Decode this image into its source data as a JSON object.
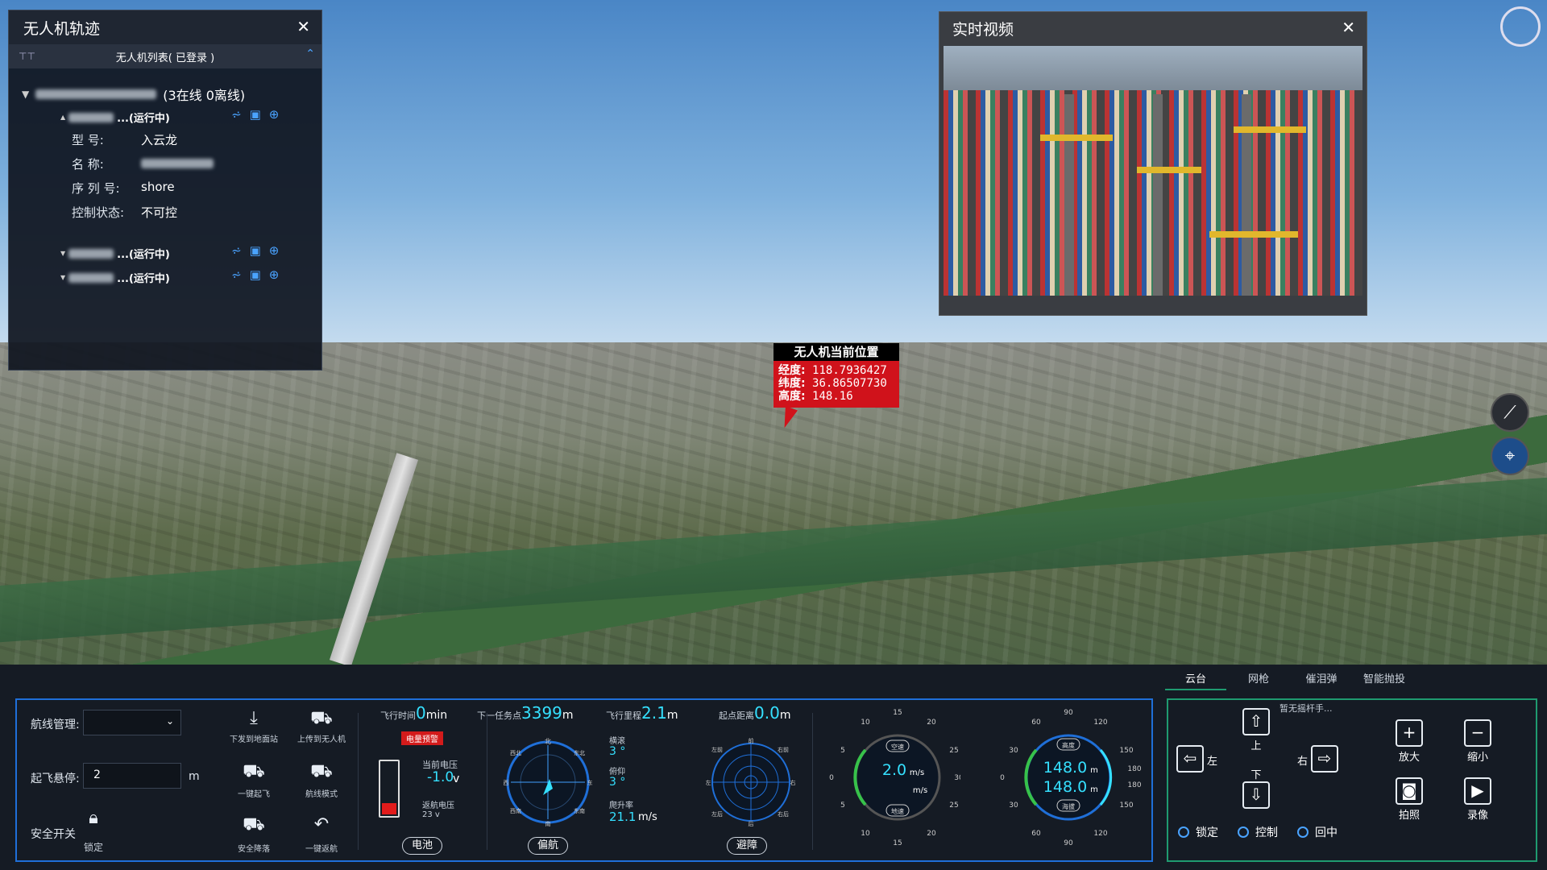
{
  "track_panel": {
    "title": "无人机轨迹",
    "close": "✕",
    "list_title": "无人机列表( 已登录 )",
    "group_status": "(3在线 0离线)",
    "drones": [
      {
        "status": "...(运行中)"
      },
      {
        "status": "...(运行中)"
      },
      {
        "status": "...(运行中)"
      }
    ],
    "details": [
      {
        "key": "型 号:",
        "value": "入云龙"
      },
      {
        "key": "名 称:",
        "value": ""
      },
      {
        "key": "序 列 号:",
        "value": "shore"
      },
      {
        "key": "控制状态:",
        "value": "不可控"
      }
    ]
  },
  "video_panel": {
    "title": "实时视频",
    "close": "✕"
  },
  "position_popup": {
    "title": "无人机当前位置",
    "lon_label": "经度:",
    "lon": "118.7936427",
    "lat_label": "纬度:",
    "lat": "36.86507730",
    "alt_label": "高度:",
    "alt": "148.16"
  },
  "dashboard": {
    "route_label": "航线管理:",
    "hover_label": "起飞悬停:",
    "hover_value": "2",
    "hover_unit": "m",
    "safety_label": "安全开关",
    "lock_label": "锁定",
    "actions": [
      {
        "label": "下发到地面站",
        "icon": "download-icon"
      },
      {
        "label": "上传到无人机",
        "icon": "drone-upload-icon"
      },
      {
        "label": "一键起飞",
        "icon": "takeoff-icon"
      },
      {
        "label": "航线模式",
        "icon": "route-mode-icon"
      },
      {
        "label": "安全降落",
        "icon": "landing-icon"
      },
      {
        "label": "一键返航",
        "icon": "return-icon"
      }
    ],
    "flight_time_label": "飞行时间",
    "flight_time": "0",
    "flight_time_unit": "min",
    "next_waypoint_label": "下一任务点",
    "next_waypoint": "3399",
    "next_waypoint_unit": "m",
    "mileage_label": "飞行里程",
    "mileage": "2.1",
    "mileage_unit": "m",
    "home_dist_label": "起点距离",
    "home_dist": "0.0",
    "home_dist_unit": "m",
    "battery_warning": "电量预警",
    "voltage_label": "当前电压",
    "voltage": "-1.0",
    "voltage_unit": "v",
    "return_voltage_label": "返航电压",
    "return_voltage": "23 v",
    "battery_level": 0.2,
    "battery_pill": "电池",
    "heading_pill": "偏航",
    "roll_label": "横滚",
    "roll": "3 °",
    "pitch_label": "俯仰",
    "pitch": "3 °",
    "climb_label": "爬升率",
    "climb": "21.1",
    "climb_unit": "m/s",
    "avoid_pill": "避障",
    "airspeed_label": "空速",
    "airspeed": "2.0",
    "airspeed_unit": "m/s",
    "ground_speed_label": "地速",
    "ground_speed_unit": "m/s",
    "speed_ticks": [
      "15",
      "20",
      "25",
      "30",
      "25",
      "20",
      "15",
      "10",
      "5",
      "0",
      "5",
      "10"
    ],
    "altitude_label": "高度",
    "altitude": "148.0",
    "altitude_unit": "m",
    "baro_label": "海拔",
    "baro": "148.0",
    "baro_unit": "m",
    "alt_ticks": [
      "90",
      "120",
      "150",
      "180",
      "180",
      "150",
      "120",
      "90",
      "60",
      "30",
      "0",
      "30",
      "60"
    ],
    "compass_labels": [
      "北",
      "东北",
      "东",
      "东南",
      "南",
      "西南",
      "西",
      "西北"
    ],
    "avoid_labels": [
      "前",
      "右前",
      "右",
      "右后",
      "后",
      "左后",
      "左",
      "左前"
    ]
  },
  "gimbal": {
    "tabs": [
      "云台",
      "网枪",
      "催泪弹",
      "智能抛投"
    ],
    "joystick_status": "暂无摇杆手...",
    "up": "上",
    "down": "下",
    "left": "左",
    "right": "右",
    "zoom_in": "放大",
    "zoom_out": "缩小",
    "photo": "拍照",
    "record": "录像",
    "modes": [
      "锁定",
      "控制",
      "回中"
    ]
  }
}
